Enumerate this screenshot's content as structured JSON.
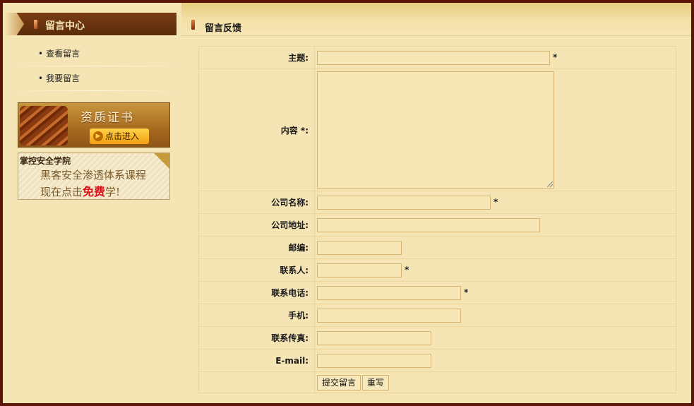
{
  "sidebar": {
    "title": "留言中心",
    "items": [
      {
        "label": "查看留言"
      },
      {
        "label": "我要留言"
      }
    ],
    "cert_banner": {
      "title": "资质证书",
      "button": "点击进入"
    },
    "academy_banner": {
      "name": "掌控安全学院",
      "line1": "黑客安全渗透体系课程",
      "line2_prefix": "现在点击",
      "line2_highlight": "免费",
      "line2_suffix": "学!"
    }
  },
  "main": {
    "title": "留言反馈",
    "form": {
      "subject_label": "主题:",
      "content_label": "内容 *:",
      "company_label": "公司名称:",
      "address_label": "公司地址:",
      "zip_label": "邮编:",
      "contact_label": "联系人:",
      "phone_label": "联系电话:",
      "mobile_label": "手机:",
      "fax_label": "联系传真:",
      "email_label": "E-mail:",
      "required_mark": "*",
      "subject_value": "",
      "content_value": "",
      "company_value": "",
      "address_value": "",
      "zip_value": "",
      "contact_value": "",
      "phone_value": "",
      "mobile_value": "",
      "fax_value": "",
      "email_value": "",
      "submit_label": "提交留言",
      "reset_label": "重写"
    }
  },
  "colors": {
    "page_bg": "#f6e5b4",
    "outer_frame": "#5a1408",
    "sidebar_header": "#5a2a0a",
    "field_border": "#d4b571",
    "highlight_red": "#e0101a"
  }
}
